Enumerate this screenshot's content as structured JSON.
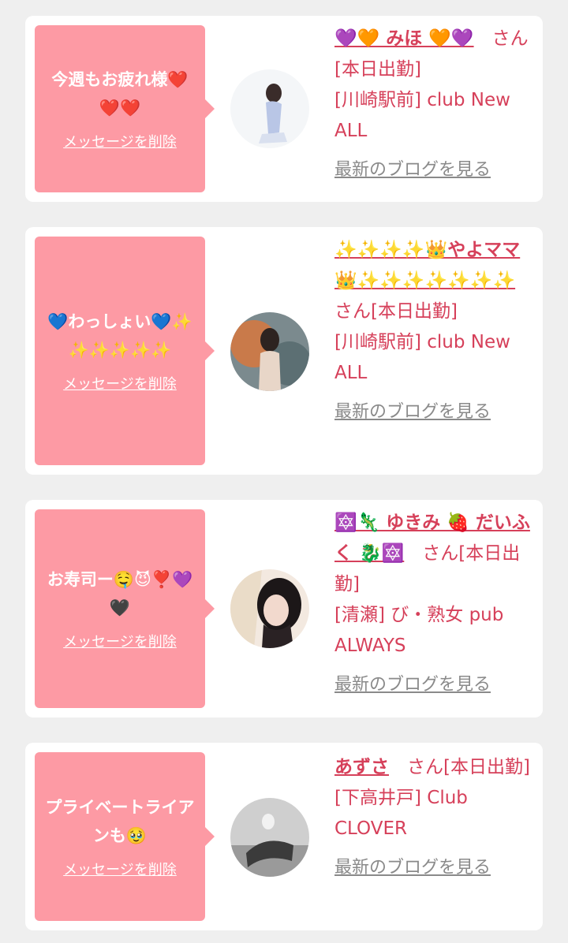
{
  "cards": [
    {
      "message": "今週もお疲れ様❤️❤️❤️",
      "delete_label": "メッセージを削除",
      "name": "💜🧡 みほ 🧡💜",
      "suffix": "　さん[本日出勤]",
      "shop": "[川崎駅前] club New ALL",
      "blog_label": "最新のブログを見る"
    },
    {
      "message": "💙わっしょい💙✨✨✨✨✨✨",
      "delete_label": "メッセージを削除",
      "name": "✨✨✨✨👑やよママ👑✨✨✨✨✨✨✨",
      "suffix": "さん[本日出勤]",
      "shop": "[川崎駅前] club New ALL",
      "blog_label": "最新のブログを見る"
    },
    {
      "message": "お寿司ー🤤😈❣️💜🖤",
      "delete_label": "メッセージを削除",
      "name": "🔯🦎 ゆきみ 🍓 だいふく 🐉🔯",
      "suffix": "　さん[本日出勤]",
      "shop": "[清瀬] び・熟女 pub ALWAYS",
      "blog_label": "最新のブログを見る"
    },
    {
      "message": "プライベートライアンも🥹",
      "delete_label": "メッセージを削除",
      "name": "あずさ",
      "suffix": "　さん[本日出勤]",
      "shop": "[下高井戸] Club CLOVER",
      "blog_label": "最新のブログを見る"
    }
  ],
  "colors": {
    "bubble": "#fd9aa4",
    "accent": "#d6405a",
    "link_gray": "#8a8a8a",
    "background": "#efefef"
  }
}
